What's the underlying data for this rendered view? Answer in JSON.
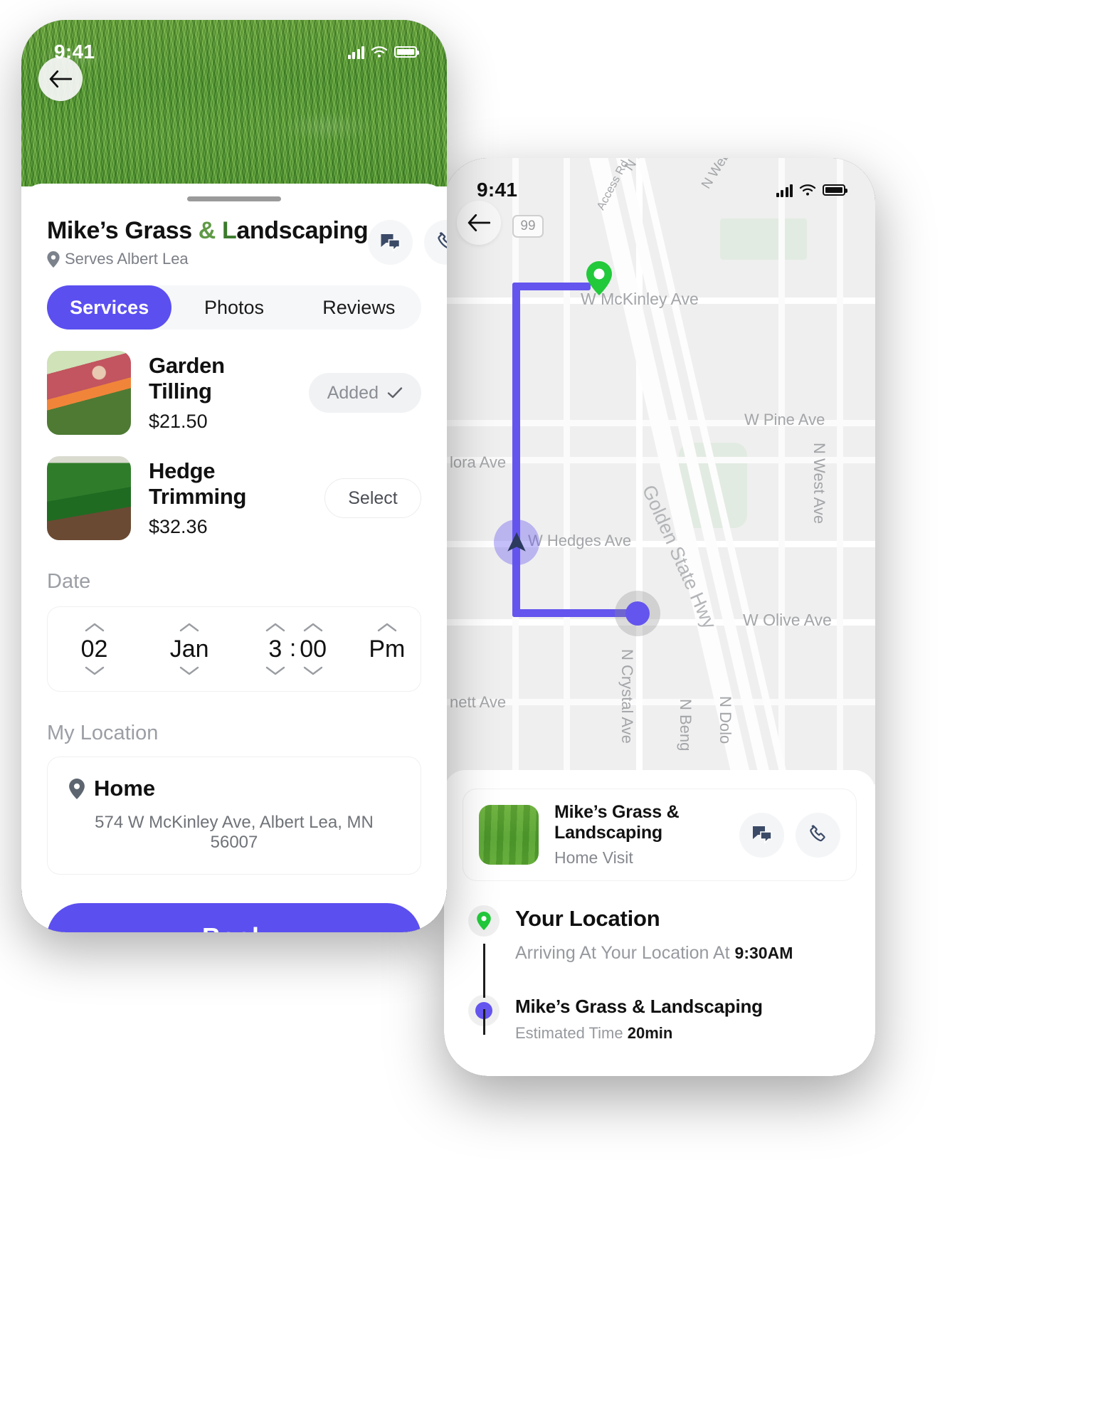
{
  "accent": "#5B4FF0",
  "green": "#22C93A",
  "phone_booking": {
    "status_bar": {
      "time": "9:41",
      "signal_icon": "cellular-bars-icon",
      "wifi_icon": "wifi-icon",
      "battery_icon": "battery-icon"
    },
    "back_icon": "back-arrow-icon",
    "hero_image": "grass-lawn-photo",
    "business": {
      "name_part1": "Mike’s Grass ",
      "name_amp": "&",
      "name_part2": " L",
      "name_part3": "andscaping",
      "full_name": "Mike’s Grass & Landscaping",
      "serves": "Serves Albert Lea",
      "location_icon": "map-pin-icon",
      "chat_icon": "chat-bubbles-icon",
      "phone_icon": "phone-handset-icon"
    },
    "tabs": [
      {
        "label": "Services",
        "active": true
      },
      {
        "label": "Photos",
        "active": false
      },
      {
        "label": "Reviews",
        "active": false
      }
    ],
    "services": [
      {
        "title": "Garden Tilling",
        "price": "$21.50",
        "action_label": "Added",
        "action_state": "added",
        "check_icon": "check-icon",
        "thumb": "man-trimming-hedge-photo"
      },
      {
        "title": "Hedge Trimming",
        "price": "$32.36",
        "action_label": "Select",
        "action_state": "select",
        "thumb": "green-tractor-tiller-photo"
      }
    ],
    "date_section": {
      "label": "Date",
      "day": "02",
      "month": "Jan",
      "hour": "3",
      "separator": ":",
      "minute": "00",
      "meridiem": "Pm",
      "up_icon": "chevron-up-icon",
      "down_icon": "chevron-down-icon"
    },
    "location_section": {
      "label": "My Location",
      "pin_icon": "map-pin-icon",
      "title": "Home",
      "address": "574 W McKinley Ave, Albert Lea, MN 56007"
    },
    "book_button": "Book"
  },
  "phone_tracking": {
    "status_bar": {
      "time": "9:41",
      "signal_icon": "cellular-bars-icon",
      "wifi_icon": "wifi-icon",
      "battery_icon": "battery-icon"
    },
    "back_icon": "back-arrow-icon",
    "map": {
      "route_color": "#6455EE",
      "origin_icon": "green-location-pin-icon",
      "vehicle_icon": "navigation-arrow-icon",
      "destination_icon": "purple-destination-dot-icon",
      "highway_shield": "99",
      "labels": [
        "N Golden State Blvd",
        "N Weber Ave",
        "Access Rd",
        "W McKinley Ave",
        "W Pine Ave",
        "N West Ave",
        "Golden State Hwy",
        "W Hedges Ave",
        "lora Ave",
        "W Olive Ave",
        "N Crystal Ave",
        "nett Ave",
        "N Beng",
        "N Dolo"
      ]
    },
    "trip_card": {
      "thumb": "grass-lawn-photo",
      "name": "Mike’s Grass & Landscaping",
      "subtitle": "Home Visit",
      "chat_icon": "chat-bubbles-icon",
      "phone_icon": "phone-handset-icon"
    },
    "timeline": [
      {
        "badge_icon": "green-location-pin-icon",
        "title": "Your Location",
        "sub_label": "Arriving At Your Location At",
        "sub_value": "9:30AM"
      },
      {
        "badge_icon": "purple-dot-icon",
        "title": "Mike’s Grass & Landscaping",
        "sub_label": "Estimated Time",
        "sub_value": "20min"
      }
    ]
  }
}
